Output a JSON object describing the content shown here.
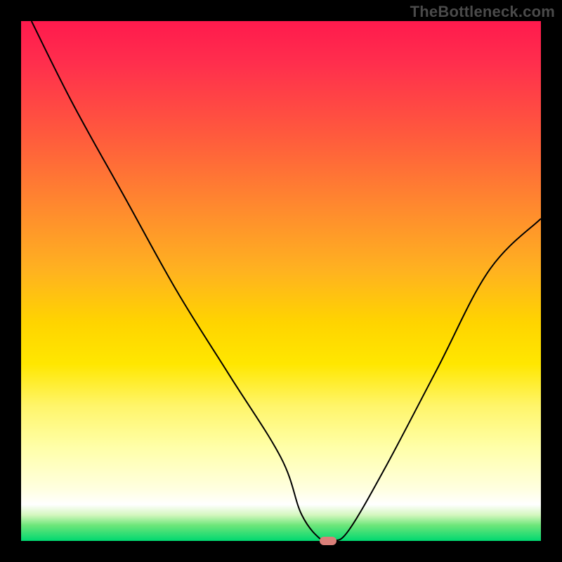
{
  "watermark": "TheBottleneck.com",
  "chart_data": {
    "type": "line",
    "title": "",
    "xlabel": "",
    "ylabel": "",
    "xlim": [
      0,
      100
    ],
    "ylim": [
      0,
      100
    ],
    "grid": false,
    "legend": false,
    "series": [
      {
        "name": "bottleneck-curve",
        "x": [
          2,
          10,
          20,
          30,
          40,
          50,
          54,
          58,
          60,
          63,
          70,
          80,
          90,
          100
        ],
        "values": [
          100,
          84,
          66,
          48,
          32,
          16,
          5,
          0,
          0,
          2,
          14,
          33,
          52,
          62
        ]
      }
    ],
    "marker": {
      "x": 59,
      "y": 0,
      "label": "optimal-point"
    },
    "background": "heat-gradient-red-to-green"
  }
}
